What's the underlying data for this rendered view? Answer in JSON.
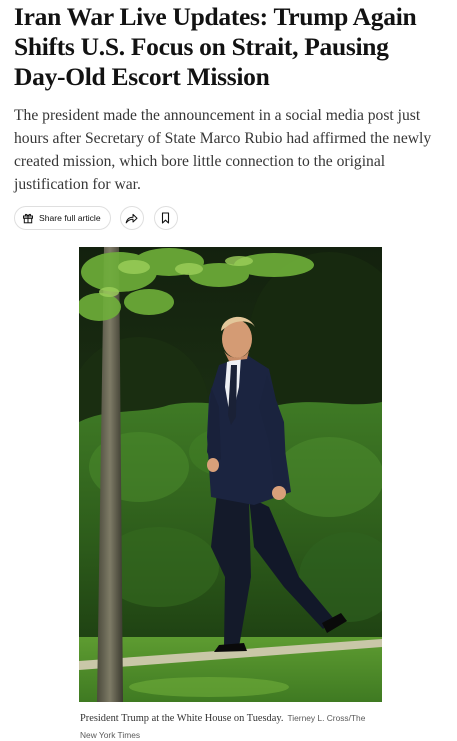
{
  "article": {
    "headline": "Iran War Live Updates: Trump Again Shifts U.S. Focus on Strait, Pausing Day-Old Escort Mission",
    "summary": "The president made the announcement in a social media post just hours after Secretary of State Marco Rubio had affirmed the newly created mission, which bore little connection to the original justification for war."
  },
  "toolbar": {
    "share_label": "Share full article",
    "share_icon": "gift-icon",
    "forward_icon": "share-arrow-icon",
    "save_icon": "bookmark-icon"
  },
  "photo": {
    "caption": "President Trump at the White House on Tuesday.",
    "credit": "Tierney L. Cross/The New York Times"
  }
}
